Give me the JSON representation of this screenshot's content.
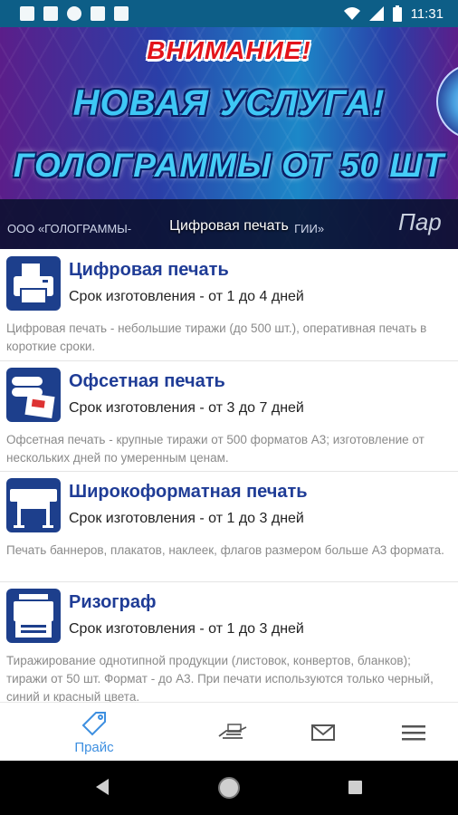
{
  "status_bar": {
    "time": "11:31"
  },
  "banner": {
    "attention": "ВНИМАНИЕ!",
    "new_service": "НОВАЯ УСЛУГА!",
    "holograms": "ГОЛОГРАММЫ ОТ 50 ШТ",
    "org_line": "ООО «ГОЛОГРАММЫ-",
    "org_tail": "ГИИ»",
    "partner": "Пар",
    "caption": "Цифровая печать"
  },
  "services": [
    {
      "title": "Цифровая печать",
      "term": "Срок изготовления - от 1 до 4 дней",
      "description": "Цифровая печать - небольшие тиражи (до 500 шт.), оперативная печать в короткие сроки.",
      "icon": "printer-icon"
    },
    {
      "title": "Офсетная печать",
      "term": "Срок изготовления - от 3 до 7 дней",
      "description": "Офсетная печать - крупные тиражи от 500 форматов А3; изготовление от нескольких дней по умеренным ценам.",
      "icon": "offset-press-icon"
    },
    {
      "title": "Широкоформатная печать",
      "term": "Срок изготовления - от 1 до 3 дней",
      "description": "Печать баннеров, плакатов, наклеек, флагов размером больше А3 формата.",
      "icon": "plotter-icon"
    },
    {
      "title": "Ризограф",
      "term": "Срок изготовления - от 1 до 3 дней",
      "description": "Тиражирование однотипной продукции (листовок, конвертов, бланков); тиражи от 50 шт. Формат - до А3. При печати используются только черный, синий и красный цвета.",
      "icon": "risograph-icon"
    }
  ],
  "tabbar": {
    "price_label": "Прайс"
  },
  "colors": {
    "accent": "#3d8fe0",
    "title_blue": "#1f3c96",
    "status_bar": "#0d5e87"
  }
}
